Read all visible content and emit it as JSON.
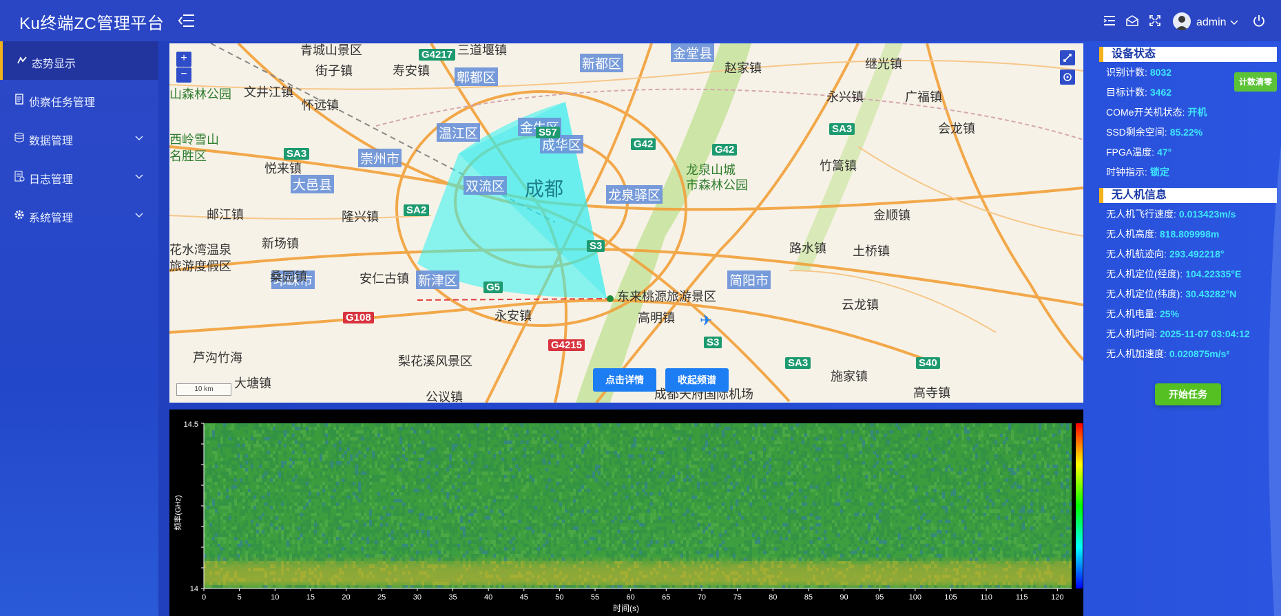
{
  "header": {
    "title": "Ku终端ZC管理平台",
    "username": "admin"
  },
  "sidebar": {
    "items": [
      {
        "label": "态势显示",
        "icon": "situation-icon",
        "active": true,
        "has_children": false
      },
      {
        "label": "侦察任务管理",
        "icon": "document-icon",
        "active": false,
        "has_children": false
      },
      {
        "label": "数据管理",
        "icon": "database-icon",
        "active": false,
        "has_children": true
      },
      {
        "label": "日志管理",
        "icon": "log-icon",
        "active": false,
        "has_children": true
      },
      {
        "label": "系统管理",
        "icon": "gear-icon",
        "active": false,
        "has_children": true
      }
    ]
  },
  "map": {
    "zoom_in": "+",
    "zoom_out": "−",
    "scale": "10 km",
    "center_label": "成都",
    "district_labels": [
      "郫都区",
      "新都区",
      "温江区",
      "金牛区",
      "成华区",
      "崇州市",
      "双流区",
      "龙泉驿区",
      "大邑县",
      "新津区",
      "邛崃市",
      "简阳市",
      "金堂县"
    ],
    "place_labels": [
      "青城山景区",
      "三道堰镇",
      "街子镇",
      "寿安镇",
      "赵家镇",
      "继光镇",
      "文井江镇",
      "怀远镇",
      "永兴镇",
      "广福镇",
      "山森林公园",
      "西岭雪山",
      "名胜区",
      "会龙镇",
      "竹篙镇",
      "悦来镇",
      "龙泉山城",
      "市森林公园",
      "邮江镇",
      "隆兴镇",
      "金顺镇",
      "花水湾温泉",
      "旅游度假区",
      "新场镇",
      "路水镇",
      "土桥镇",
      "桑园镇",
      "安仁古镇",
      "东来桃源旅游景区",
      "永安镇",
      "高明镇",
      "云龙镇",
      "芦沟竹海",
      "梨花溪风景区",
      "大塘镇",
      "公议镇",
      "施家镇",
      "高寺镇",
      "成都天府国际机场"
    ],
    "road_labels": [
      "G4217",
      "S57",
      "G42",
      "G42",
      "SA3",
      "SA2",
      "S3",
      "G5",
      "G108",
      "G4215",
      "S3",
      "SA3",
      "SA3",
      "S40"
    ],
    "buttons": {
      "details": "点击详情",
      "collapse": "收起频谱"
    }
  },
  "spectrum": {
    "y_axis_label": "频率(GHz)",
    "y_max": "14.5",
    "y_min": "14",
    "x_axis_label": "时间(s)",
    "x_ticks": [
      "0",
      "5",
      "10",
      "15",
      "20",
      "25",
      "30",
      "35",
      "40",
      "45",
      "50",
      "55",
      "60",
      "65",
      "70",
      "75",
      "80",
      "85",
      "90",
      "95",
      "100",
      "105",
      "110",
      "115",
      "120"
    ]
  },
  "device_status": {
    "title": "设备状态",
    "reset_button": "计数清零",
    "items": [
      {
        "label": "识别计数:",
        "value": "8032"
      },
      {
        "label": "目标计数:",
        "value": "3462"
      },
      {
        "label": "COMe开关机状态:",
        "value": "开机"
      },
      {
        "label": "SSD剩余空间:",
        "value": "85.22%"
      },
      {
        "label": "FPGA温度:",
        "value": "47°"
      },
      {
        "label": "时钟指示:",
        "value": "锁定"
      }
    ]
  },
  "uav_info": {
    "title": "无人机信息",
    "items": [
      {
        "label": "无人机飞行速度:",
        "value": "0.013423m/s"
      },
      {
        "label": "无人机高度:",
        "value": "818.809998m"
      },
      {
        "label": "无人机航迹向:",
        "value": "293.492218°"
      },
      {
        "label": "无人机定位(经度):",
        "value": "104.22335°E"
      },
      {
        "label": "无人机定位(纬度):",
        "value": "30.43282°N"
      },
      {
        "label": "无人机电量:",
        "value": "25%"
      },
      {
        "label": "无人机时间:",
        "value": "2025-11-07 03:04:12"
      },
      {
        "label": "无人机加速度:",
        "value": "0.020875m/s²"
      }
    ],
    "start_button": "开始任务"
  },
  "colors": {
    "header_bg": "#2a46c5",
    "accent_yellow": "#f2b21c",
    "value_cyan": "#3ee7ff",
    "button_blue": "#1d7ef4",
    "button_green": "#54c021"
  }
}
